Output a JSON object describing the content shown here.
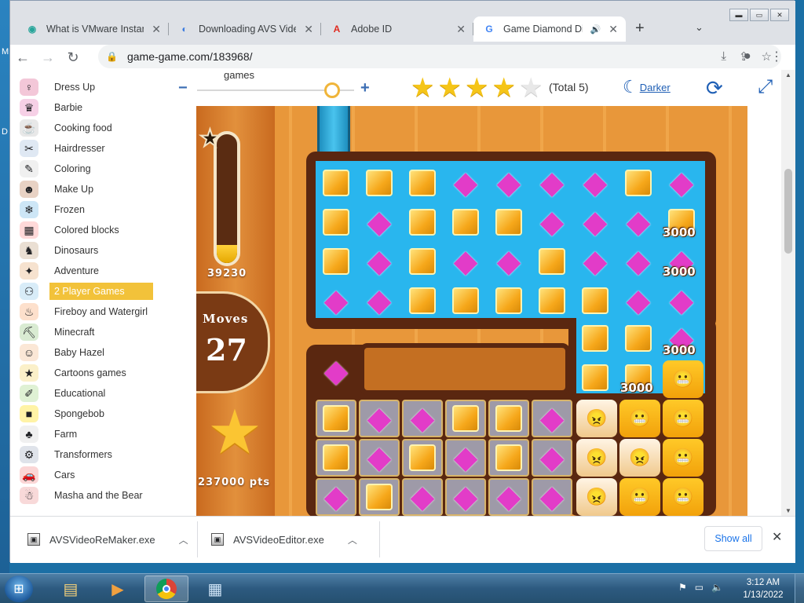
{
  "desktop": {
    "letters": [
      "M",
      "D"
    ]
  },
  "window_controls": {
    "minimize": "▬",
    "maximize": "▭",
    "close": "✕"
  },
  "tabs": [
    {
      "title": "What is VMware Instant",
      "icon": "vmware-icon",
      "active": false
    },
    {
      "title": "Downloading AVS Video",
      "icon": "avs-icon",
      "active": false
    },
    {
      "title": "Adobe ID",
      "icon": "adobe-icon",
      "active": false
    },
    {
      "title": "Game Diamond Dig",
      "icon": "google-icon",
      "active": true,
      "audio": true
    }
  ],
  "toolbar": {
    "url": "game-game.com/183968/"
  },
  "sidebar": {
    "items": [
      {
        "label": "Dress Up",
        "color": "#f3c7d8",
        "glyph": "♀"
      },
      {
        "label": "Barbie",
        "color": "#f6d0e6",
        "glyph": "♛"
      },
      {
        "label": "Cooking food",
        "color": "#e8e8e8",
        "glyph": "☕"
      },
      {
        "label": "Hairdresser",
        "color": "#dfe8f3",
        "glyph": "✂"
      },
      {
        "label": "Coloring",
        "color": "#f0f0f0",
        "glyph": "✎"
      },
      {
        "label": "Make Up",
        "color": "#e8d2c4",
        "glyph": "☻"
      },
      {
        "label": "Frozen",
        "color": "#cde6f6",
        "glyph": "❄"
      },
      {
        "label": "Colored blocks",
        "color": "#ffd9d9",
        "glyph": "▦"
      },
      {
        "label": "Dinosaurs",
        "color": "#eadfd3",
        "glyph": "♞"
      },
      {
        "label": "Adventure",
        "color": "#f6e2cf",
        "glyph": "✦"
      },
      {
        "label": "2 Player Games",
        "color": "#d8ecf8",
        "glyph": "⚇",
        "selected": true
      },
      {
        "label": "Fireboy and Watergirl",
        "color": "#fde0cc",
        "glyph": "♨"
      },
      {
        "label": "Minecraft",
        "color": "#d9ebd2",
        "glyph": "⛏"
      },
      {
        "label": "Baby Hazel",
        "color": "#fbe7d6",
        "glyph": "☺"
      },
      {
        "label": "Cartoons games",
        "color": "#fbf0c9",
        "glyph": "★"
      },
      {
        "label": "Educational",
        "color": "#dff1d4",
        "glyph": "✐"
      },
      {
        "label": "Spongebob",
        "color": "#fff3a6",
        "glyph": "■"
      },
      {
        "label": "Farm",
        "color": "#f0f0f0",
        "glyph": "♣"
      },
      {
        "label": "Transformers",
        "color": "#dfe3ea",
        "glyph": "⚙"
      },
      {
        "label": "Cars",
        "color": "#fbd6d6",
        "glyph": "🚗"
      },
      {
        "label": "Masha and the Bear",
        "color": "#f8d9d9",
        "glyph": "☃"
      }
    ]
  },
  "controls": {
    "games_label": "games",
    "zoom_minus": "−",
    "zoom_plus": "+",
    "zoom_level": 0.86,
    "rating_stars": 4,
    "rating_max": 5,
    "rating_total": "(Total 5)",
    "darker_label": "Darker"
  },
  "game": {
    "progress_score": "39230",
    "progress_fill": 0.14,
    "moves_label": "Moves",
    "moves_value": "27",
    "points": "237000 pts",
    "combo_label": "3000"
  },
  "downloads": {
    "items": [
      {
        "name": "AVSVideoReMaker.exe"
      },
      {
        "name": "AVSVideoEditor.exe"
      }
    ],
    "show_all": "Show all"
  },
  "taskbar": {
    "time": "3:12 AM",
    "date": "1/13/2022"
  }
}
